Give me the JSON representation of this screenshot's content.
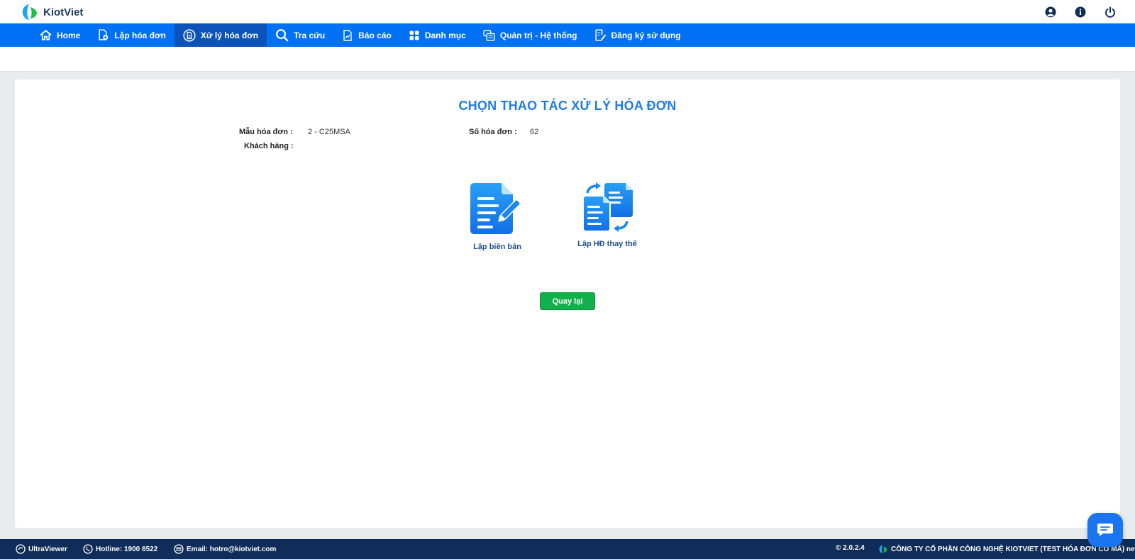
{
  "app": {
    "name": "KiotViet"
  },
  "nav": {
    "items": [
      {
        "label": "Home",
        "icon": "home-icon"
      },
      {
        "label": "Lập hóa đơn",
        "icon": "create-invoice-icon"
      },
      {
        "label": "Xử lý hóa đơn",
        "icon": "process-invoice-icon",
        "active": true
      },
      {
        "label": "Tra cứu",
        "icon": "search-icon"
      },
      {
        "label": "Báo cáo",
        "icon": "report-icon"
      },
      {
        "label": "Danh mục",
        "icon": "category-icon"
      },
      {
        "label": "Quản trị - Hệ thống",
        "icon": "admin-icon"
      },
      {
        "label": "Đăng ký sử dụng",
        "icon": "register-icon"
      }
    ]
  },
  "page": {
    "title": "CHỌN THAO TÁC XỬ LÝ HÓA ĐƠN",
    "fields": {
      "template_label": "Mẫu hóa đơn :",
      "template_value": "2 - C25MSA",
      "invoice_no_label": "Số hóa đơn :",
      "invoice_no_value": "62",
      "customer_label": "Khách hàng :",
      "customer_value": ""
    },
    "actions": {
      "minutes_label": "Lập biên bản",
      "replace_label": "Lập HĐ thay thế"
    },
    "back_button": "Quay lại"
  },
  "footer": {
    "ultraviewer": "UltraViewer",
    "hotline": "Hotline: 1900 6522",
    "email": "Email: hotro@kiotviet.com",
    "version": "© 2.0.2.4",
    "company": "CÔNG TY CỔ PHẦN CÔNG NGHỆ KIOTVIET (TEST HÓA ĐƠN CÓ MÃ) new"
  },
  "colors": {
    "primary": "#0070f4",
    "nav_active": "#0b53b8",
    "title": "#1e7ce8",
    "button_green": "#12b04a",
    "footer": "#0f2d58"
  }
}
